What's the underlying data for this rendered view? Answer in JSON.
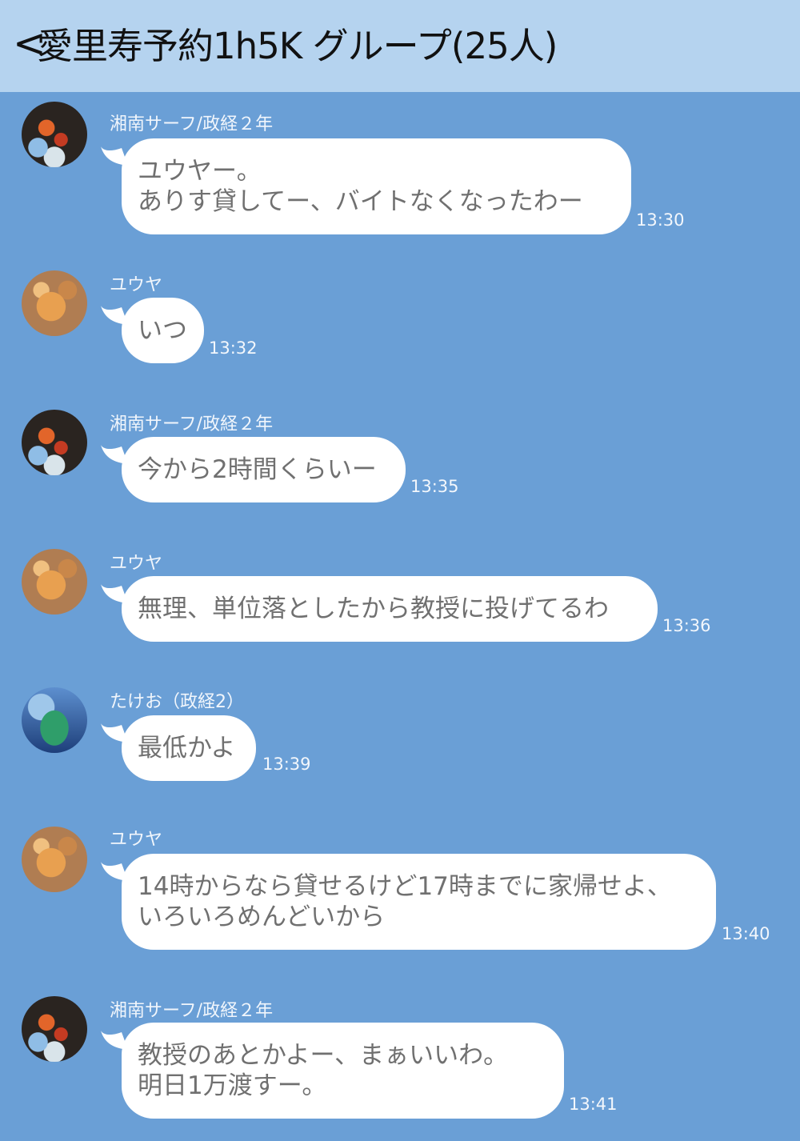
{
  "header": {
    "back_glyph": "<",
    "title": "愛里寿予約1h5K グループ(25人)"
  },
  "messages": [
    {
      "sender": "湘南サーフ/政経２年",
      "avatar": "surf-avatar",
      "text": "ユウヤー。\nありす貸してー、バイトなくなったわー",
      "time": "13:30"
    },
    {
      "sender": "ユウヤ",
      "avatar": "dog-avatar",
      "text": "いつ",
      "time": "13:32"
    },
    {
      "sender": "湘南サーフ/政経２年",
      "avatar": "surf-avatar",
      "text": "今から2時間くらいー",
      "time": "13:35"
    },
    {
      "sender": "ユウヤ",
      "avatar": "dog-avatar",
      "text": "無理、単位落としたから教授に投げてるわ",
      "time": "13:36"
    },
    {
      "sender": "たけお（政経2）",
      "avatar": "car-avatar",
      "text": "最低かよ",
      "time": "13:39"
    },
    {
      "sender": "ユウヤ",
      "avatar": "dog-avatar",
      "text": "14時からなら貸せるけど17時までに家帰せよ、\nいろいろめんどいから",
      "time": "13:40"
    },
    {
      "sender": "湘南サーフ/政経２年",
      "avatar": "surf-avatar",
      "text": "教授のあとかよー、まぁいいわ。\n明日1万渡すー。",
      "time": "13:41"
    }
  ]
}
